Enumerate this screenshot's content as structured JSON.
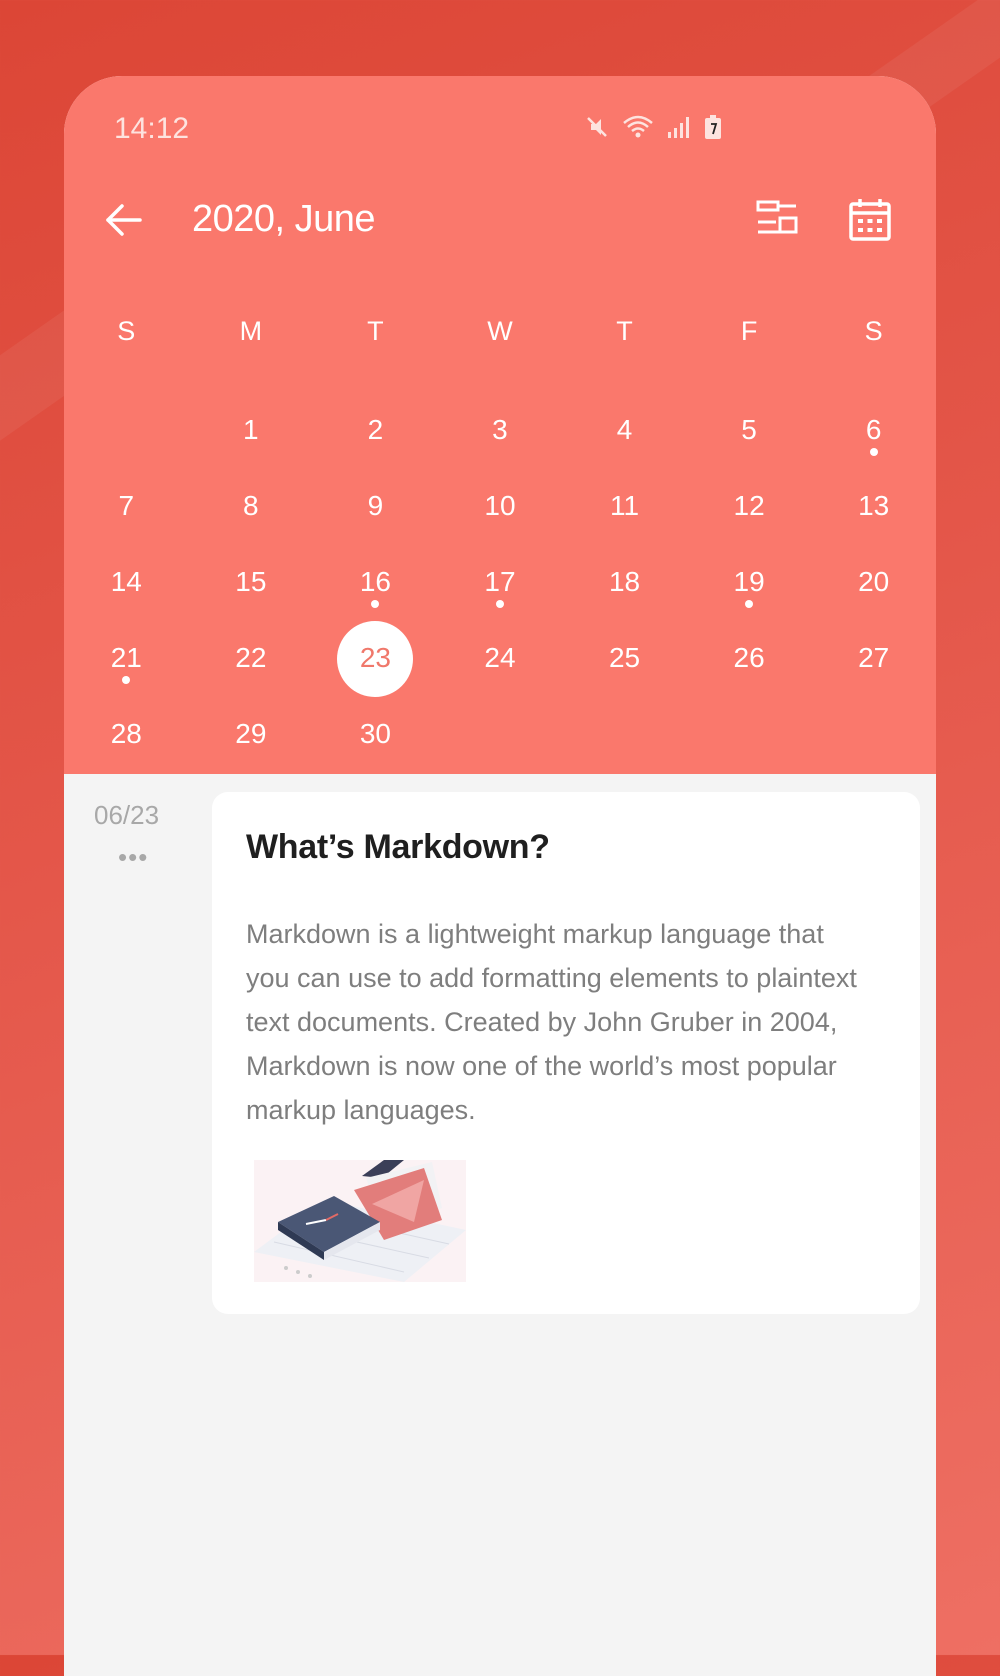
{
  "status_bar": {
    "time": "14:12"
  },
  "header": {
    "title": "2020, June"
  },
  "calendar": {
    "weekdays": [
      "S",
      "M",
      "T",
      "W",
      "T",
      "F",
      "S"
    ],
    "weeks": [
      [
        "",
        "1",
        "2",
        "3",
        "4",
        "5",
        "6"
      ],
      [
        "7",
        "8",
        "9",
        "10",
        "11",
        "12",
        "13"
      ],
      [
        "14",
        "15",
        "16",
        "17",
        "18",
        "19",
        "20"
      ],
      [
        "21",
        "22",
        "23",
        "24",
        "25",
        "26",
        "27"
      ],
      [
        "28",
        "29",
        "30",
        "",
        "",
        "",
        ""
      ]
    ],
    "selected_day": "23",
    "days_with_entries": [
      "6",
      "16",
      "17",
      "19",
      "21"
    ]
  },
  "entry": {
    "date": "06/23",
    "more": "•••",
    "title": "What’s Markdown?",
    "body": "Markdown is a lightweight markup language that you can use to add formatting elements to plaintext text documents. Created by John Gruber in 2004, Markdown is now one of the world’s most popular markup languages."
  },
  "colors": {
    "header": "#fa786c",
    "background": "#dc4636",
    "selected_text": "#f0786b"
  }
}
